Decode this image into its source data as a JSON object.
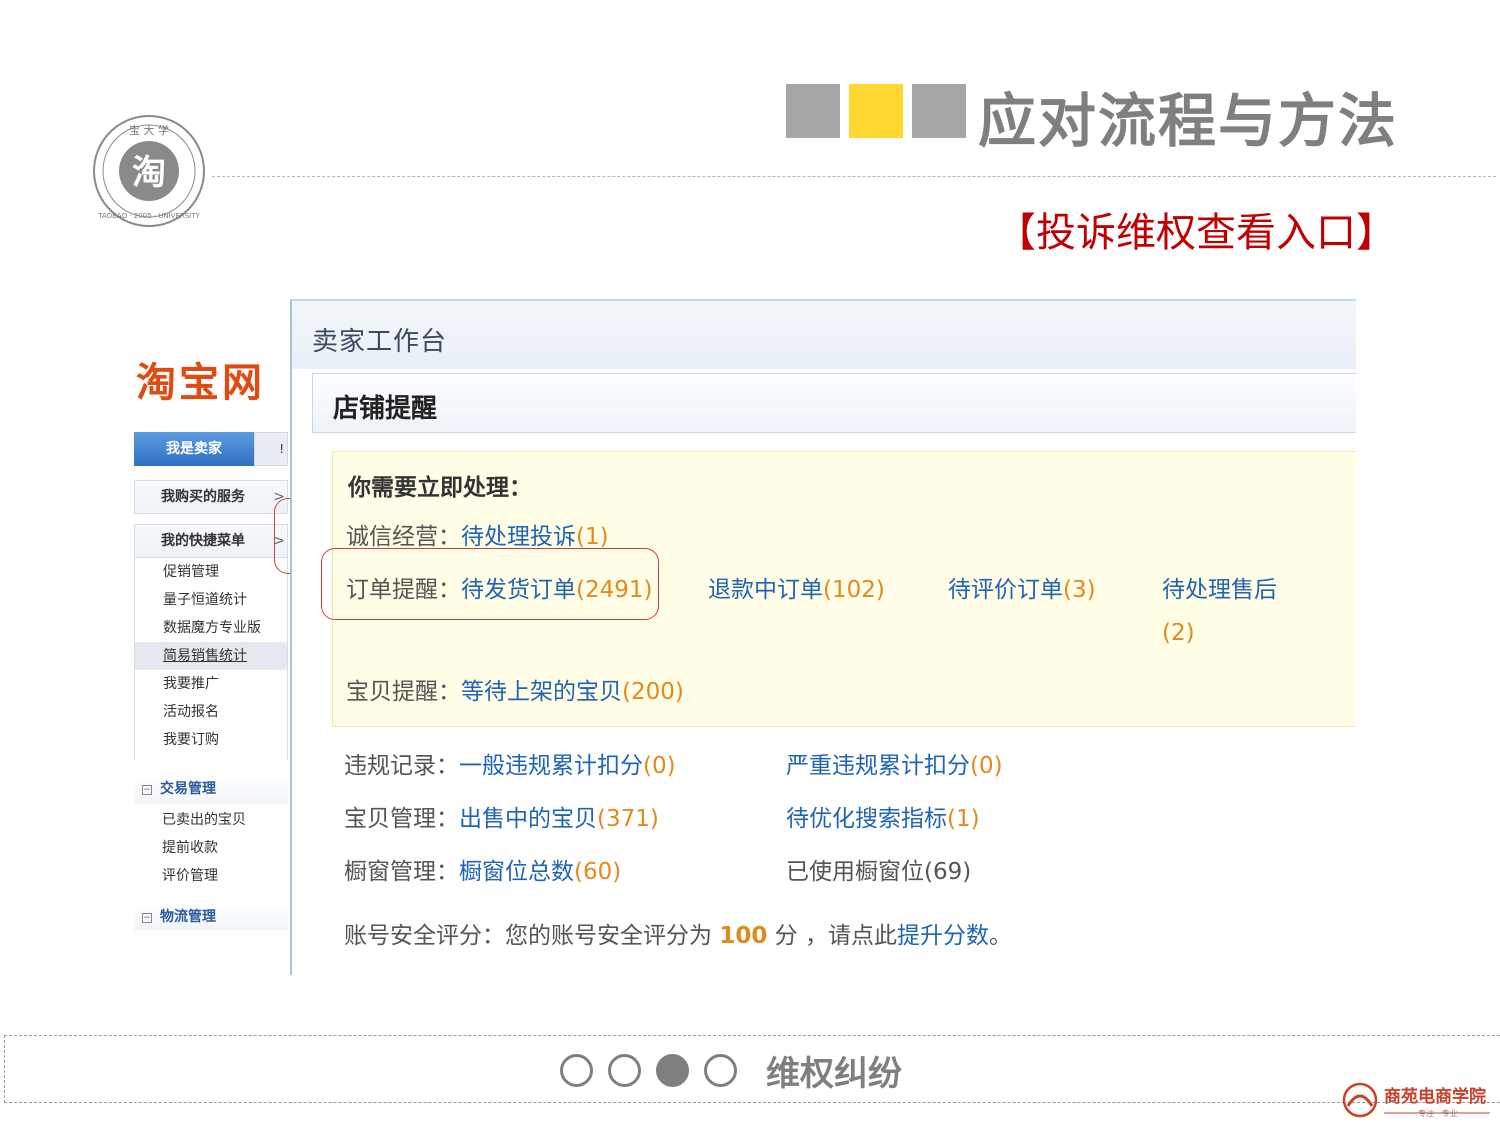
{
  "slide": {
    "title": "应对流程与方法",
    "subtitle": "【投诉维权查看入口】",
    "seal_text": "淘宝大学 TAOBAO · 2005 · UNIVERSITY",
    "footer_label": "维权纠纷",
    "footer_logo_text": "商苑电商学院",
    "footer_logo_tagline": "专注 · 专业",
    "progress": {
      "total": 4,
      "current": 3
    },
    "colors": {
      "title_gray": "#7f7f7f",
      "accent_yellow": "#ffd731",
      "subtitle_red": "#c00000"
    }
  },
  "left_panel": {
    "logo": "淘宝网",
    "seller_button": "我是卖家",
    "seller_button_suffix": "!",
    "purchased_services": "我购买的服务",
    "quick_menu": {
      "title": "我的快捷菜单",
      "items": [
        "促销管理",
        "量子恒道统计",
        "数据魔方专业版",
        "简易销售统计",
        "我要推广",
        "活动报名",
        "我要订购"
      ]
    },
    "trade_section": {
      "title": "交易管理",
      "items": [
        "已卖出的宝贝",
        "提前收款",
        "评价管理"
      ]
    },
    "logistics_section": {
      "title": "物流管理"
    },
    "arrow": ">"
  },
  "workbench": {
    "title": "卖家工作台",
    "store_reminder_title": "店铺提醒",
    "urgent_heading": "你需要立即处理：",
    "integrity": {
      "label": "诚信经营：",
      "link": "待处理投诉",
      "count": "(1)"
    },
    "orders": {
      "label": "订单提醒：",
      "items": [
        {
          "link": "待发货订单",
          "count": "(2491)"
        },
        {
          "link": "退款中订单",
          "count": "(102)"
        },
        {
          "link": "待评价订单",
          "count": "(3)"
        },
        {
          "link": "待处理售后",
          "count": "(2)"
        }
      ]
    },
    "items_reminder": {
      "label": "宝贝提醒：",
      "link": "等待上架的宝贝",
      "count": "(200)"
    },
    "violations": {
      "label": "违规记录：",
      "general_link": "一般违规累计扣分",
      "general_count": "(0)",
      "serious_link": "严重违规累计扣分",
      "serious_count": "(0)"
    },
    "item_management": {
      "label": "宝贝管理：",
      "onsale_link": "出售中的宝贝",
      "onsale_count": "(371)",
      "optimize_link": "待优化搜索指标",
      "optimize_count": "(1)"
    },
    "showcase": {
      "label": "橱窗管理：",
      "total_link": "橱窗位总数",
      "total_count": "(60)",
      "used_text": "已使用橱窗位(69)"
    },
    "security": {
      "label": "账号安全评分：",
      "prefix": "您的账号安全评分为",
      "score": "100",
      "unit": "分",
      "middle": "，请点此",
      "link": "提升分数",
      "end": "。"
    }
  }
}
